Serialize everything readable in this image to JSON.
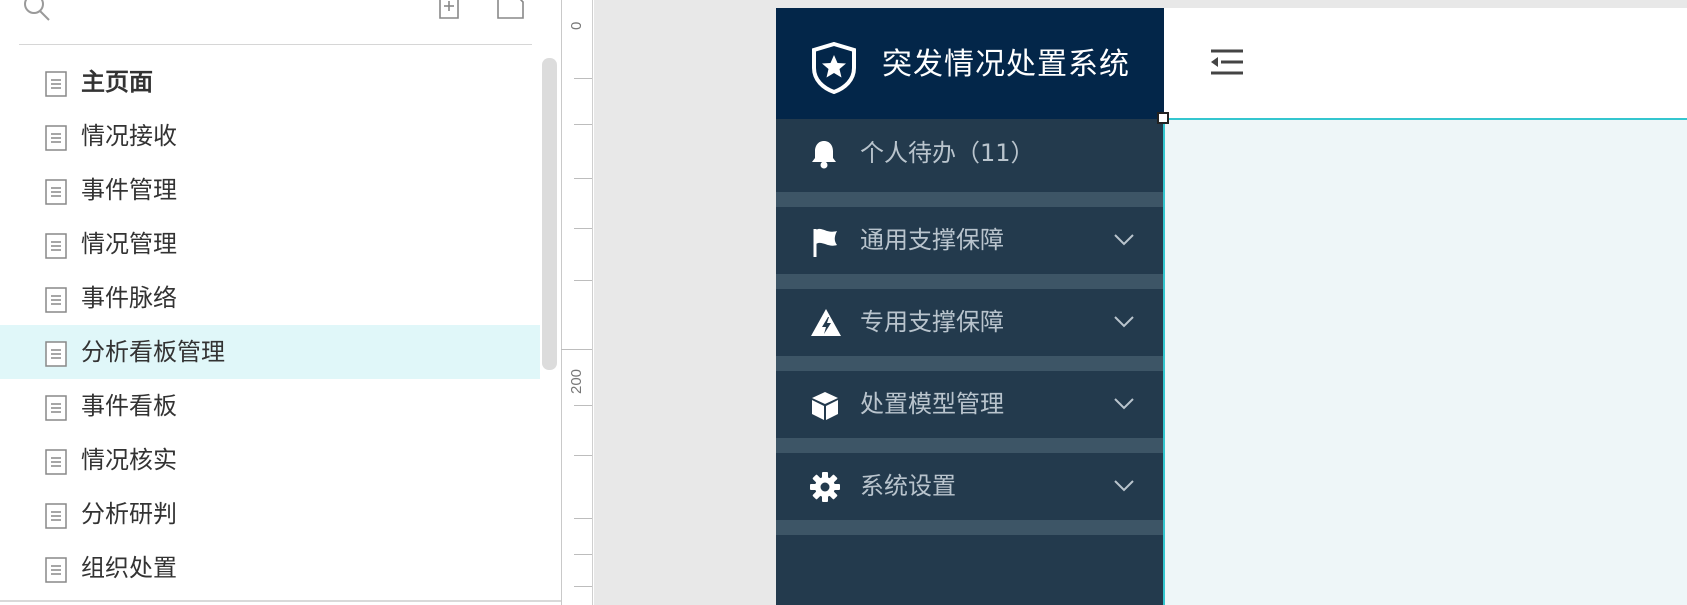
{
  "pages_panel": {
    "items": [
      {
        "label": "主页面"
      },
      {
        "label": "情况接收"
      },
      {
        "label": "事件管理"
      },
      {
        "label": "情况管理"
      },
      {
        "label": "事件脉络"
      },
      {
        "label": "分析看板管理"
      },
      {
        "label": "事件看板"
      },
      {
        "label": "情况核实"
      },
      {
        "label": "分析研判"
      },
      {
        "label": "组织处置"
      }
    ],
    "selected_index": 5
  },
  "ruler": {
    "labels": [
      "0",
      "200"
    ]
  },
  "app": {
    "title": "突发情况处置系统",
    "nav": [
      {
        "label": "个人待办（11）",
        "icon": "bell-icon",
        "expandable": false
      },
      {
        "label": "通用支撑保障",
        "icon": "flag-icon",
        "expandable": true
      },
      {
        "label": "专用支撑保障",
        "icon": "warning-icon",
        "expandable": true
      },
      {
        "label": "处置模型管理",
        "icon": "cube-icon",
        "expandable": true
      },
      {
        "label": "系统设置",
        "icon": "gear-icon",
        "expandable": true
      }
    ]
  },
  "colors": {
    "header_bg": "#032649",
    "sidebar_bg": "#233a4d",
    "nav_separator": "#3d5566",
    "nav_text": "#b9c4cd",
    "selection_bg": "#e0f7f9",
    "accent_border": "#34c6cf",
    "content_bg": "#eef6f8"
  }
}
